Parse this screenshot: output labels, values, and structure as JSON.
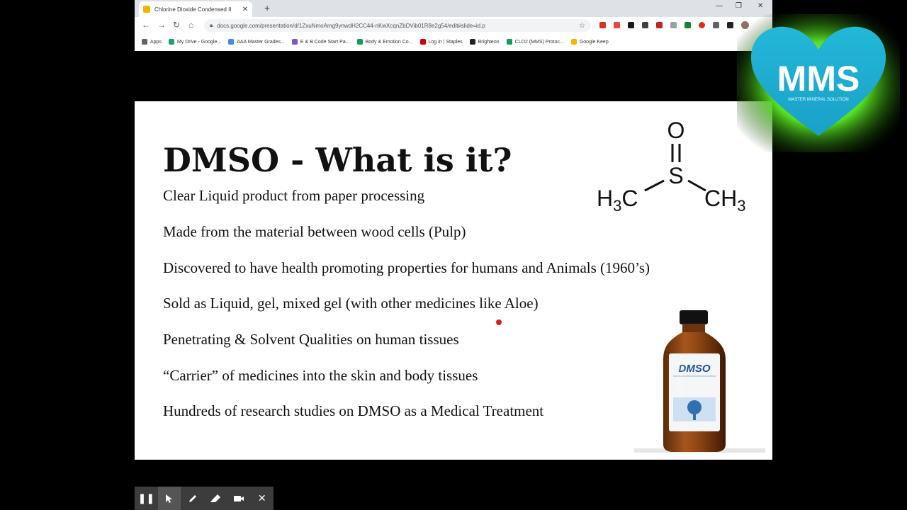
{
  "browser": {
    "tab_title": "Chlorine Dioxide Condensed II",
    "url": "docs.google.com/presentation/d/1ZxuNmoAmg9ynwdH2CC44-nKwXcqnZbDVib01R8e2g54/edit#slide=id.p",
    "bookmarks": [
      {
        "label": "Apps",
        "color": "#5f6368"
      },
      {
        "label": "My Drive - Google...",
        "color": "#1fa463"
      },
      {
        "label": "AAA Master Grades...",
        "color": "#4285f4"
      },
      {
        "label": "E & B Code Start Pa...",
        "color": "#7e57c2"
      },
      {
        "label": "Body & Emotion Co...",
        "color": "#0f9d58"
      },
      {
        "label": "Log in | Staples",
        "color": "#cc0000"
      },
      {
        "label": "Brighteon",
        "color": "#222222"
      },
      {
        "label": "CLO2 (MMS) Protoc...",
        "color": "#0f9d58"
      },
      {
        "label": "Google Keep",
        "color": "#f4b400"
      }
    ]
  },
  "slide": {
    "title": "DMSO - What is it?",
    "bullets": [
      "Clear Liquid product from paper processing",
      "Made from the material between wood cells (Pulp)",
      "Discovered to have health promoting properties for humans and Animals (1960’s)",
      "Sold as Liquid, gel, mixed gel (with other medicines like Aloe)",
      "Penetrating & Solvent Qualities on human tissues",
      "“Carrier” of medicines into the skin and body tissues",
      "Hundreds of research studies on DMSO as a Medical Treatment"
    ],
    "molecule": {
      "top": "O",
      "center": "S",
      "left": "H",
      "left_sub": "3",
      "left_tail": "C",
      "right": "CH",
      "right_sub": "3"
    },
    "bottle_label": "DMSO"
  },
  "logo": {
    "text": "MMS",
    "tagline": "MASTER MINERAL SOLUTION"
  },
  "presenter_toolbar": {
    "icons": [
      "pause-icon",
      "cursor-icon",
      "pen-icon",
      "marker-icon",
      "camera-icon",
      "close-icon"
    ]
  }
}
